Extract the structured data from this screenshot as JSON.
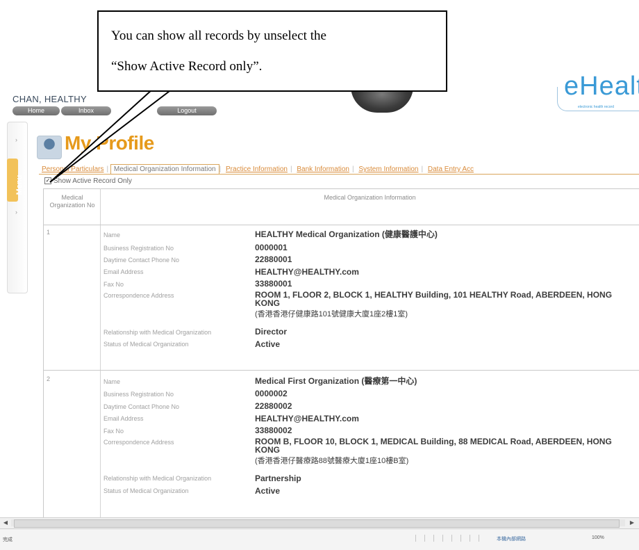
{
  "callout": {
    "line1": "You can show all records by unselect the",
    "line2": "“Show Active Record only”."
  },
  "header": {
    "user_name": "CHAN, HEALTHY",
    "nav": [
      "Home",
      "Inbox",
      "Logout"
    ],
    "logo_text": "eHealth",
    "logo_subtext": "electronic health record"
  },
  "menu": {
    "label": "Menu",
    "icons": [
      "arrow-icon",
      "arrow-icon"
    ]
  },
  "page": {
    "title": "My Profile"
  },
  "tabs": [
    {
      "label": "Personal Particulars",
      "active": false
    },
    {
      "label": "Medical Organization Information",
      "active": true
    },
    {
      "label": "Practice Information",
      "active": false
    },
    {
      "label": "Bank Information",
      "active": false
    },
    {
      "label": "System Information",
      "active": false
    },
    {
      "label": "Data Entry Acc",
      "active": false
    }
  ],
  "filter": {
    "checkbox_checked": true,
    "label": "Show Active Record Only"
  },
  "table": {
    "header_no": "Medical Organization No",
    "header_info": "Medical Organization Information",
    "labels": {
      "name": "Name",
      "brn": "Business Registration No",
      "phone": "Daytime Contact Phone No",
      "email": "Email Address",
      "fax": "Fax No",
      "address": "Correspondence Address",
      "relationship": "Relationship with Medical Organization",
      "status": "Status of Medical Organization"
    },
    "records": [
      {
        "no": "1",
        "name": "HEALTHY Medical Organization (健康醫護中心)",
        "brn": "0000001",
        "phone": "22880001",
        "email": "HEALTHY@HEALTHY.com",
        "fax": "33880001",
        "address_en": "ROOM 1, FLOOR 2, BLOCK 1, HEALTHY Building, 101 HEALTHY Road, ABERDEEN, HONG KONG",
        "address_zh": "(香港香港仔健康路101號健康大廈1座2樓1室)",
        "relationship": "Director",
        "status": "Active"
      },
      {
        "no": "2",
        "name": "Medical First Organization (醫療第一中心)",
        "brn": "0000002",
        "phone": "22880002",
        "email": "HEALTHY@HEALTHY.com",
        "fax": "33880002",
        "address_en": "ROOM B, FLOOR 10, BLOCK 1, MEDICAL Building, 88 MEDICAL Road, ABERDEEN, HONG KONG",
        "address_zh": "(香港香港仔醫療路88號醫療大廈1座10樓B室)",
        "relationship": "Partnership",
        "status": "Active"
      }
    ]
  },
  "statusbar": {
    "left": "完成",
    "zone": "本機內部網路",
    "zoom": "100%"
  }
}
